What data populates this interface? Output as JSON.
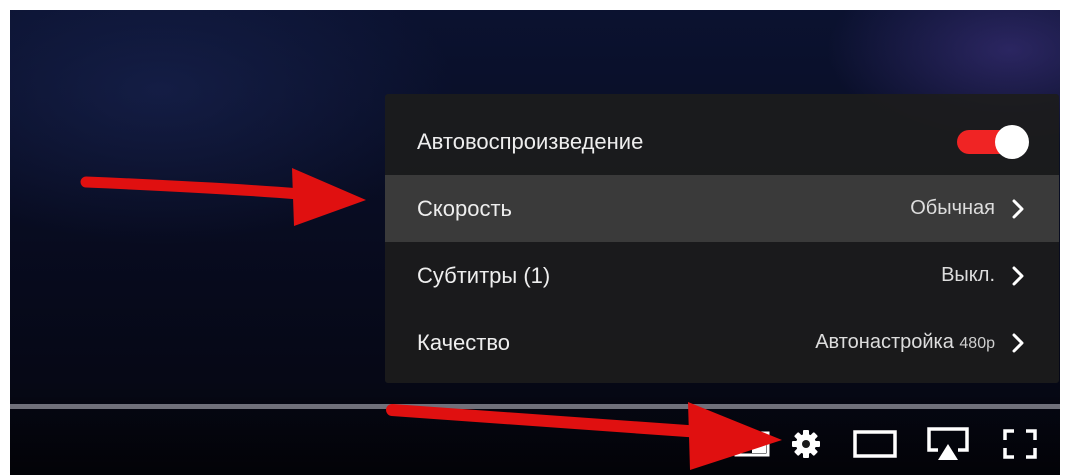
{
  "settings_menu": {
    "items": [
      {
        "label": "Автовоспроизведение",
        "type": "toggle",
        "on": true
      },
      {
        "label": "Скорость",
        "value": "Обычная",
        "highlighted": true
      },
      {
        "label": "Субтитры (1)",
        "value": "Выкл."
      },
      {
        "label": "Качество",
        "value": "Автонастройка",
        "value_suffix": "480p"
      }
    ],
    "toggle_color": "#f02424"
  },
  "controls": {
    "icons": [
      "miniplayer-icon",
      "settings-gear-icon",
      "theater-mode-icon",
      "airplay-icon",
      "fullscreen-icon"
    ]
  },
  "annotations": {
    "arrow_color": "#e01010"
  }
}
